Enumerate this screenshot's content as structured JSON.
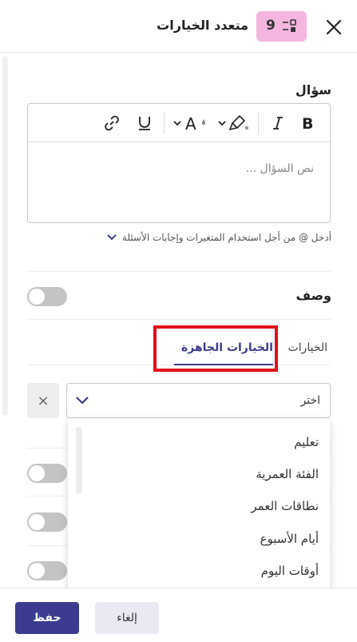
{
  "header": {
    "title": "متعدد الخيارات",
    "type_count": "9",
    "close_icon": "close-icon",
    "type_icon": "multiple-choice-icon",
    "badge_color": "#f4b6df"
  },
  "question": {
    "label": "سؤال",
    "placeholder": "نص السؤال ...",
    "toolbar": [
      "bold-icon",
      "italic-icon",
      "highlight-color-icon",
      "text-color-icon",
      "underline-icon",
      "link-icon"
    ],
    "hint": "أدخل @ من أجل استخدام المتغيرات وإجابات الأسئلة"
  },
  "description": {
    "label": "وصف",
    "enabled": false
  },
  "tabs": {
    "options": "الخيارات",
    "ready_options": "الخيارات الجاهزة",
    "active": "ready_options"
  },
  "select": {
    "value": "اختر",
    "clear_label": "×",
    "options": [
      "تعليم",
      "الفئة العمرية",
      "نطاقات العمر",
      "أيام الأسبوع",
      "أوقات اليوم"
    ]
  },
  "footer": {
    "save": "حفظ",
    "cancel": "إلغاء"
  },
  "colors": {
    "accent": "#3b3b8f",
    "highlight_border": "#e01018"
  }
}
